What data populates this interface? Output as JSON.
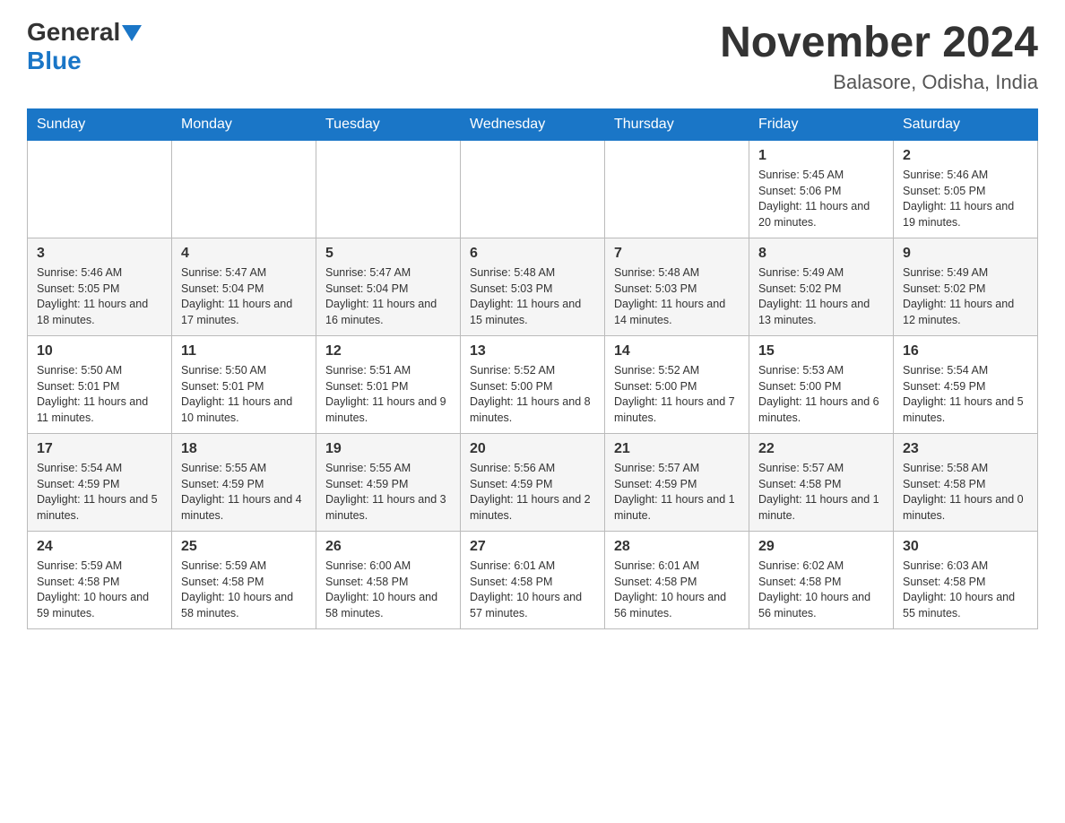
{
  "header": {
    "logo_general": "General",
    "logo_blue": "Blue",
    "month_title": "November 2024",
    "location": "Balasore, Odisha, India"
  },
  "days_of_week": [
    "Sunday",
    "Monday",
    "Tuesday",
    "Wednesday",
    "Thursday",
    "Friday",
    "Saturday"
  ],
  "weeks": [
    {
      "days": [
        {
          "number": "",
          "info": ""
        },
        {
          "number": "",
          "info": ""
        },
        {
          "number": "",
          "info": ""
        },
        {
          "number": "",
          "info": ""
        },
        {
          "number": "",
          "info": ""
        },
        {
          "number": "1",
          "info": "Sunrise: 5:45 AM\nSunset: 5:06 PM\nDaylight: 11 hours and 20 minutes."
        },
        {
          "number": "2",
          "info": "Sunrise: 5:46 AM\nSunset: 5:05 PM\nDaylight: 11 hours and 19 minutes."
        }
      ]
    },
    {
      "days": [
        {
          "number": "3",
          "info": "Sunrise: 5:46 AM\nSunset: 5:05 PM\nDaylight: 11 hours and 18 minutes."
        },
        {
          "number": "4",
          "info": "Sunrise: 5:47 AM\nSunset: 5:04 PM\nDaylight: 11 hours and 17 minutes."
        },
        {
          "number": "5",
          "info": "Sunrise: 5:47 AM\nSunset: 5:04 PM\nDaylight: 11 hours and 16 minutes."
        },
        {
          "number": "6",
          "info": "Sunrise: 5:48 AM\nSunset: 5:03 PM\nDaylight: 11 hours and 15 minutes."
        },
        {
          "number": "7",
          "info": "Sunrise: 5:48 AM\nSunset: 5:03 PM\nDaylight: 11 hours and 14 minutes."
        },
        {
          "number": "8",
          "info": "Sunrise: 5:49 AM\nSunset: 5:02 PM\nDaylight: 11 hours and 13 minutes."
        },
        {
          "number": "9",
          "info": "Sunrise: 5:49 AM\nSunset: 5:02 PM\nDaylight: 11 hours and 12 minutes."
        }
      ]
    },
    {
      "days": [
        {
          "number": "10",
          "info": "Sunrise: 5:50 AM\nSunset: 5:01 PM\nDaylight: 11 hours and 11 minutes."
        },
        {
          "number": "11",
          "info": "Sunrise: 5:50 AM\nSunset: 5:01 PM\nDaylight: 11 hours and 10 minutes."
        },
        {
          "number": "12",
          "info": "Sunrise: 5:51 AM\nSunset: 5:01 PM\nDaylight: 11 hours and 9 minutes."
        },
        {
          "number": "13",
          "info": "Sunrise: 5:52 AM\nSunset: 5:00 PM\nDaylight: 11 hours and 8 minutes."
        },
        {
          "number": "14",
          "info": "Sunrise: 5:52 AM\nSunset: 5:00 PM\nDaylight: 11 hours and 7 minutes."
        },
        {
          "number": "15",
          "info": "Sunrise: 5:53 AM\nSunset: 5:00 PM\nDaylight: 11 hours and 6 minutes."
        },
        {
          "number": "16",
          "info": "Sunrise: 5:54 AM\nSunset: 4:59 PM\nDaylight: 11 hours and 5 minutes."
        }
      ]
    },
    {
      "days": [
        {
          "number": "17",
          "info": "Sunrise: 5:54 AM\nSunset: 4:59 PM\nDaylight: 11 hours and 5 minutes."
        },
        {
          "number": "18",
          "info": "Sunrise: 5:55 AM\nSunset: 4:59 PM\nDaylight: 11 hours and 4 minutes."
        },
        {
          "number": "19",
          "info": "Sunrise: 5:55 AM\nSunset: 4:59 PM\nDaylight: 11 hours and 3 minutes."
        },
        {
          "number": "20",
          "info": "Sunrise: 5:56 AM\nSunset: 4:59 PM\nDaylight: 11 hours and 2 minutes."
        },
        {
          "number": "21",
          "info": "Sunrise: 5:57 AM\nSunset: 4:59 PM\nDaylight: 11 hours and 1 minute."
        },
        {
          "number": "22",
          "info": "Sunrise: 5:57 AM\nSunset: 4:58 PM\nDaylight: 11 hours and 1 minute."
        },
        {
          "number": "23",
          "info": "Sunrise: 5:58 AM\nSunset: 4:58 PM\nDaylight: 11 hours and 0 minutes."
        }
      ]
    },
    {
      "days": [
        {
          "number": "24",
          "info": "Sunrise: 5:59 AM\nSunset: 4:58 PM\nDaylight: 10 hours and 59 minutes."
        },
        {
          "number": "25",
          "info": "Sunrise: 5:59 AM\nSunset: 4:58 PM\nDaylight: 10 hours and 58 minutes."
        },
        {
          "number": "26",
          "info": "Sunrise: 6:00 AM\nSunset: 4:58 PM\nDaylight: 10 hours and 58 minutes."
        },
        {
          "number": "27",
          "info": "Sunrise: 6:01 AM\nSunset: 4:58 PM\nDaylight: 10 hours and 57 minutes."
        },
        {
          "number": "28",
          "info": "Sunrise: 6:01 AM\nSunset: 4:58 PM\nDaylight: 10 hours and 56 minutes."
        },
        {
          "number": "29",
          "info": "Sunrise: 6:02 AM\nSunset: 4:58 PM\nDaylight: 10 hours and 56 minutes."
        },
        {
          "number": "30",
          "info": "Sunrise: 6:03 AM\nSunset: 4:58 PM\nDaylight: 10 hours and 55 minutes."
        }
      ]
    }
  ]
}
